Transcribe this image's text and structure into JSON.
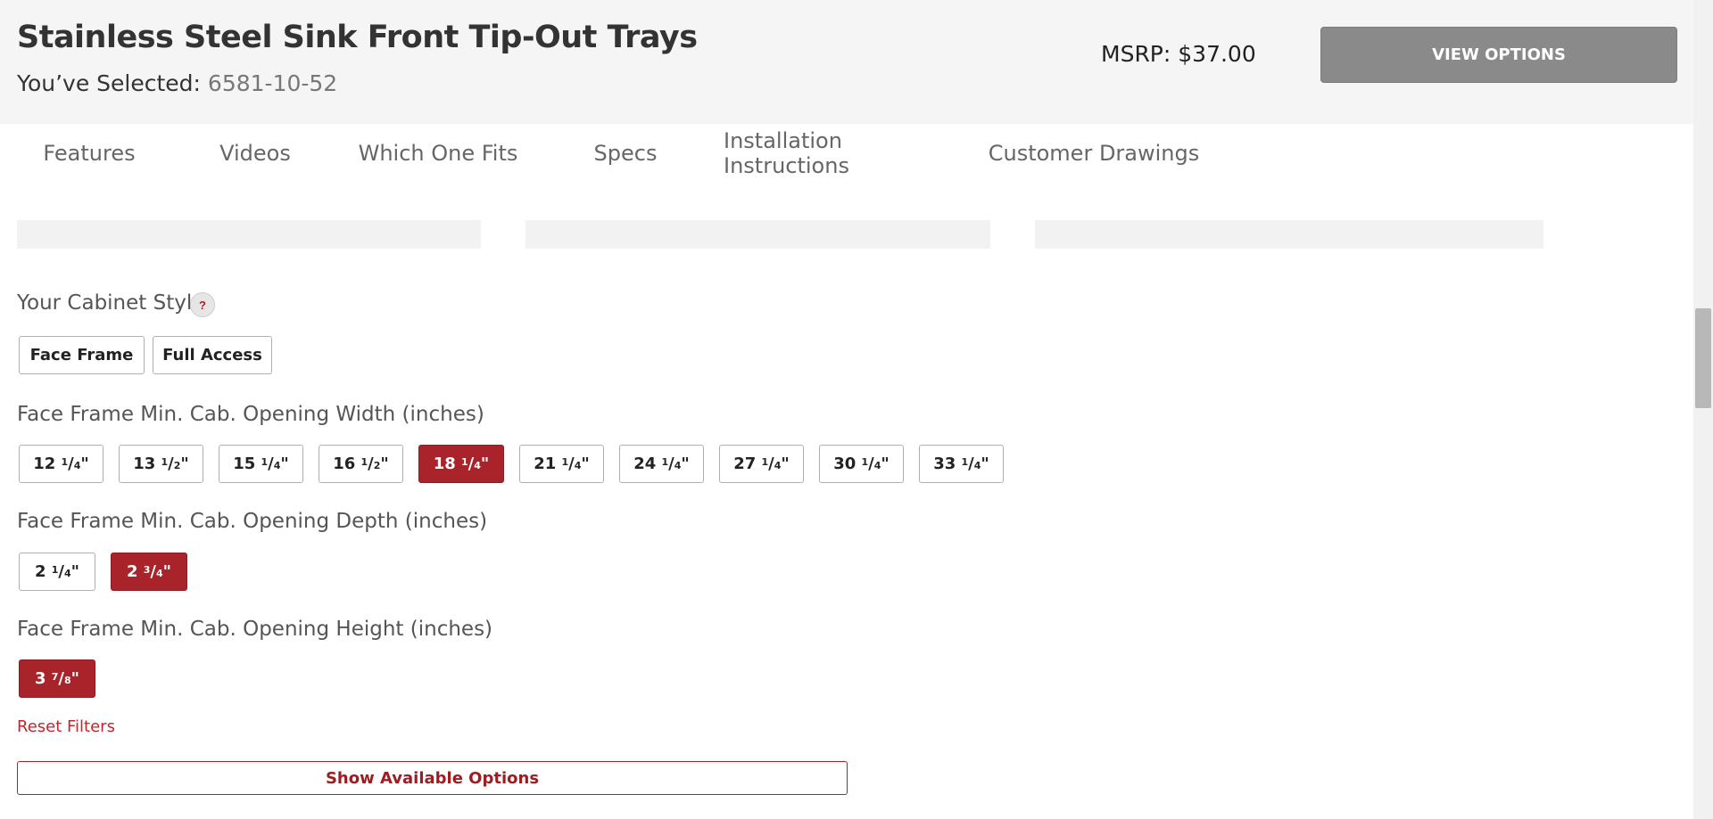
{
  "header": {
    "title": "Stainless Steel Sink Front Tip-Out Trays",
    "selected_label": "You’ve Selected:",
    "selected_sku": "6581-10-52",
    "msrp": "MSRP: $37.00",
    "view_options_label": "VIEW OPTIONS"
  },
  "tabs": [
    {
      "label": "Features",
      "active": true
    },
    {
      "label": "Videos",
      "active": false
    },
    {
      "label": "Which One Fits",
      "active": false
    },
    {
      "label": "Specs",
      "active": false
    },
    {
      "label": "Installation Instructions",
      "active": false
    },
    {
      "label": "Customer Drawings",
      "active": false
    }
  ],
  "cabinet_style": {
    "label": "Your Cabinet Style:",
    "help_icon": "question-mark-icon",
    "help_glyph": "?",
    "options": [
      {
        "label": "Face Frame",
        "active": true
      },
      {
        "label": "Full Access",
        "active": false
      }
    ]
  },
  "width": {
    "label": "Face Frame Min. Cab. Opening Width (inches)",
    "options": [
      {
        "whole": "12",
        "num": "1",
        "den": "4",
        "active": false
      },
      {
        "whole": "13",
        "num": "1",
        "den": "2",
        "active": false
      },
      {
        "whole": "15",
        "num": "1",
        "den": "4",
        "active": false
      },
      {
        "whole": "16",
        "num": "1",
        "den": "2",
        "active": false
      },
      {
        "whole": "18",
        "num": "1",
        "den": "4",
        "active": true
      },
      {
        "whole": "21",
        "num": "1",
        "den": "4",
        "active": false
      },
      {
        "whole": "24",
        "num": "1",
        "den": "4",
        "active": false
      },
      {
        "whole": "27",
        "num": "1",
        "den": "4",
        "active": false
      },
      {
        "whole": "30",
        "num": "1",
        "den": "4",
        "active": false
      },
      {
        "whole": "33",
        "num": "1",
        "den": "4",
        "active": false
      }
    ]
  },
  "depth": {
    "label": "Face Frame Min. Cab. Opening Depth (inches)",
    "options": [
      {
        "whole": "2",
        "num": "1",
        "den": "4",
        "active": false
      },
      {
        "whole": "2",
        "num": "3",
        "den": "4",
        "active": true
      }
    ]
  },
  "height": {
    "label": "Face Frame Min. Cab. Opening Height (inches)",
    "options": [
      {
        "whole": "3",
        "num": "7",
        "den": "8",
        "active": true
      }
    ]
  },
  "reset_label": "Reset Filters",
  "show_options_label": "Show Available Options",
  "colors": {
    "accent": "#b22026",
    "active_button": "#a8232a",
    "view_options_bg": "#8a8a8a",
    "header_bg": "#f5f5f5"
  }
}
